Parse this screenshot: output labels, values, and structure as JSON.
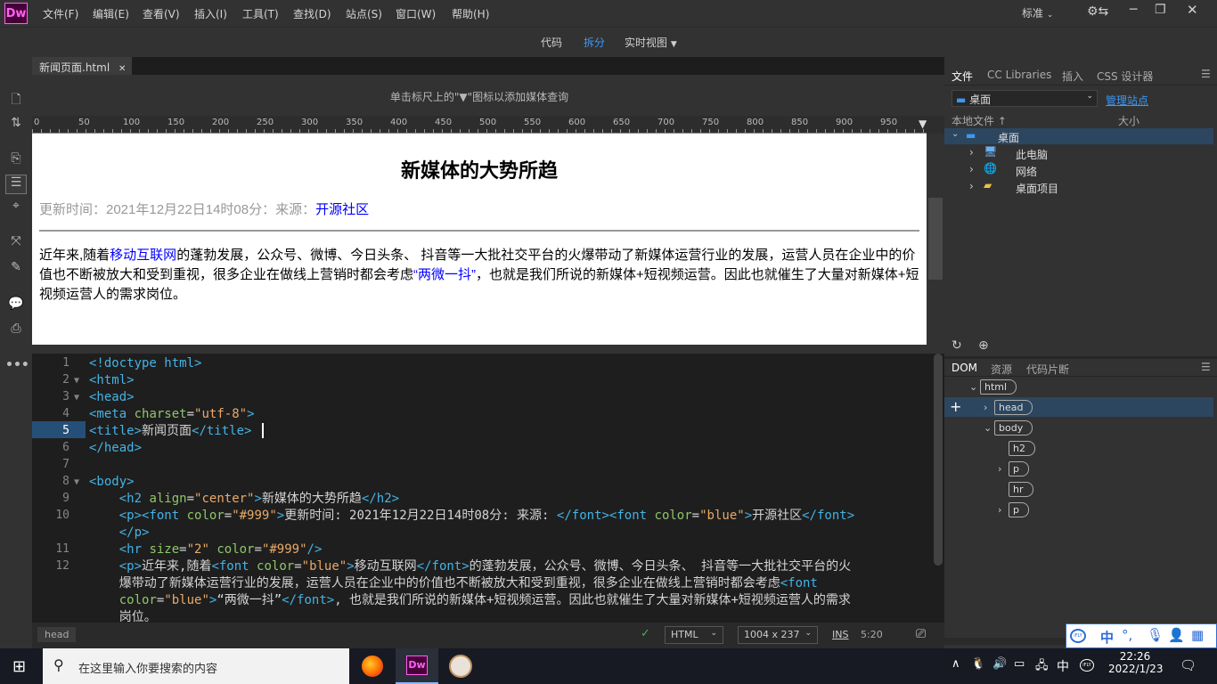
{
  "app": {
    "logo": "Dw",
    "menus": [
      "文件(F)",
      "编辑(E)",
      "查看(V)",
      "插入(I)",
      "工具(T)",
      "查找(D)",
      "站点(S)",
      "窗口(W)",
      "帮助(H)"
    ],
    "workspace": "标准"
  },
  "view_modes": {
    "code": "代码",
    "split": "拆分",
    "live": "实时视图"
  },
  "document": {
    "tab": "新闻页面.html",
    "mq_hint": "单击标尺上的\"▼\"图标以添加媒体查询",
    "ruler": [
      "0",
      "50",
      "100",
      "150",
      "200",
      "250",
      "300",
      "350",
      "400",
      "450",
      "500",
      "550",
      "600",
      "650",
      "700",
      "750",
      "800",
      "850",
      "900",
      "950"
    ]
  },
  "preview": {
    "heading": "新媒体的大势所趋",
    "meta_prefix": "更新时间：2021年12月22日14时08分：来源：",
    "meta_source": "开源社区",
    "p1": "近年来,随着",
    "p_link1": "移动互联网",
    "p2": "的蓬勃发展，公众号、微博、今日头条、 抖音等一大批社交平台的火爆带动了新媒体运营行业的发展，运营人员在企业中的价值也不断被放大和受到重视，很多企业在做线上营销时都会考虑",
    "p_link2": "“两微一抖”",
    "p3": "，也就是我们所说的新媒体+短视频运营。因此也就催生了大量对新媒体+短视频运营人的需求岗位。"
  },
  "code_lines": [
    {
      "n": "1",
      "fold": "",
      "html": "<span class=\"t\">&lt;!doctype html&gt;</span>"
    },
    {
      "n": "2",
      "fold": "▼",
      "html": "<span class=\"t\">&lt;html&gt;</span>"
    },
    {
      "n": "3",
      "fold": "▼",
      "html": "<span class=\"t\">&lt;head&gt;</span>"
    },
    {
      "n": "4",
      "fold": "",
      "html": "<span class=\"t\">&lt;meta</span> <span class=\"an\">charset</span>=<span class=\"av\">\"utf-8\"</span><span class=\"t\">&gt;</span>"
    },
    {
      "n": "5",
      "fold": "",
      "html": "<span class=\"t\">&lt;title&gt;</span>新闻页面<span class=\"t\">&lt;/title&gt;</span>"
    },
    {
      "n": "6",
      "fold": "",
      "html": "<span class=\"t\">&lt;/head&gt;</span>"
    },
    {
      "n": "7",
      "fold": "",
      "html": ""
    },
    {
      "n": "8",
      "fold": "▼",
      "html": "<span class=\"t\">&lt;body&gt;</span>"
    },
    {
      "n": "9",
      "fold": "",
      "html": "    <span class=\"t\">&lt;h2</span> <span class=\"an\">align</span>=<span class=\"av\">\"center\"</span><span class=\"t\">&gt;</span>新媒体的大势所趋<span class=\"t\">&lt;/h2&gt;</span>"
    },
    {
      "n": "10",
      "fold": "",
      "html": "    <span class=\"t\">&lt;p&gt;&lt;font</span> <span class=\"an\">color</span>=<span class=\"av\">\"#999\"</span><span class=\"t\">&gt;</span>更新时间: 2021年12月22日14时08分: 来源: <span class=\"t\">&lt;/font&gt;&lt;font</span> <span class=\"an\">color</span>=<span class=\"av\">\"blue\"</span><span class=\"t\">&gt;</span>开源社区<span class=\"t\">&lt;/font&gt;</span>\n    <span class=\"t\">&lt;/p&gt;</span>"
    },
    {
      "n": "11",
      "fold": "",
      "html": "    <span class=\"t\">&lt;hr</span> <span class=\"an\">size</span>=<span class=\"av\">\"2\"</span> <span class=\"an\">color</span>=<span class=\"av\">\"#999\"</span><span class=\"t\">/&gt;</span>"
    },
    {
      "n": "12",
      "fold": "",
      "html": "    <span class=\"t\">&lt;p&gt;</span>近年来,随着<span class=\"t\">&lt;font</span> <span class=\"an\">color</span>=<span class=\"av\">\"blue\"</span><span class=\"t\">&gt;</span>移动互联网<span class=\"t\">&lt;/font&gt;</span>的蓬勃发展，公众号、微博、今日头条、 抖音等一大批社交平台的火\n    爆带动了新媒体运营行业的发展，运营人员在企业中的价值也不断被放大和受到重视，很多企业在做线上营销时都会考虑<span class=\"t\">&lt;font</span>\n    <span class=\"an\">color</span>=<span class=\"av\">\"blue\"</span><span class=\"t\">&gt;</span>“两微一抖”<span class=\"t\">&lt;/font&gt;</span>, 也就是我们所说的新媒体+短视频运营。因此也就催生了大量对新媒体+短视频运营人的需求\n    岗位。"
    }
  ],
  "status": {
    "tag": "head",
    "lang": "HTML",
    "size": "1004 x 237",
    "ins": "INS",
    "pos": "5:20"
  },
  "files_panel": {
    "tabs": [
      "文件",
      "CC Libraries",
      "插入",
      "CSS 设计器"
    ],
    "location": "桌面",
    "manage": "管理站点",
    "col_local": "本地文件 ↑",
    "col_size": "大小",
    "root": "桌面",
    "items": [
      "此电脑",
      "网络",
      "桌面项目"
    ]
  },
  "dom_panel": {
    "tabs": [
      "DOM",
      "资源",
      "代码片断"
    ],
    "nodes": [
      {
        "label": "html",
        "indent": 0,
        "arrow": "⌄"
      },
      {
        "label": "head",
        "indent": 1,
        "arrow": "›"
      },
      {
        "label": "body",
        "indent": 1,
        "arrow": "⌄"
      },
      {
        "label": "h2",
        "indent": 2,
        "arrow": ""
      },
      {
        "label": "p",
        "indent": 2,
        "arrow": "›"
      },
      {
        "label": "hr",
        "indent": 2,
        "arrow": ""
      },
      {
        "label": "p",
        "indent": 2,
        "arrow": "›"
      }
    ]
  },
  "ime": {
    "logo": "iFLY",
    "lang": "中"
  },
  "taskbar": {
    "search_placeholder": "在这里输入你要搜索的内容",
    "tray_lang": "中",
    "time": "22:26",
    "date": "2022/1/23"
  }
}
